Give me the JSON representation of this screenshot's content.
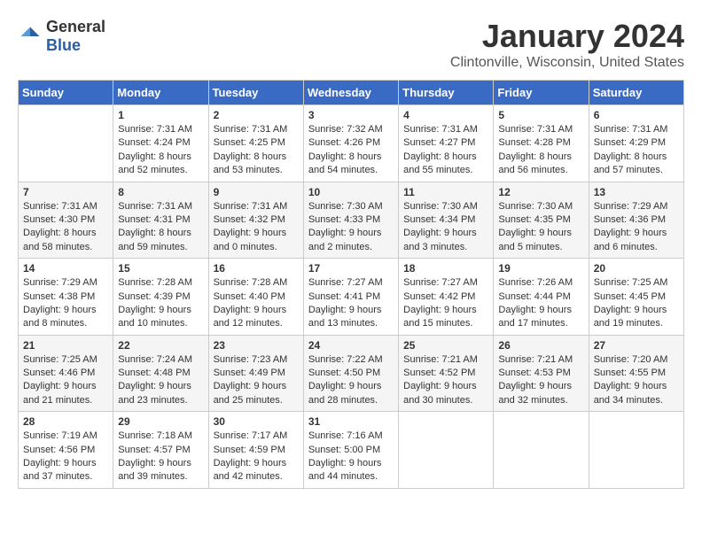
{
  "header": {
    "logo_general": "General",
    "logo_blue": "Blue",
    "month_title": "January 2024",
    "location": "Clintonville, Wisconsin, United States"
  },
  "days_of_week": [
    "Sunday",
    "Monday",
    "Tuesday",
    "Wednesday",
    "Thursday",
    "Friday",
    "Saturday"
  ],
  "weeks": [
    [
      {
        "day": "",
        "sunrise": "",
        "sunset": "",
        "daylight": ""
      },
      {
        "day": "1",
        "sunrise": "Sunrise: 7:31 AM",
        "sunset": "Sunset: 4:24 PM",
        "daylight": "Daylight: 8 hours and 52 minutes."
      },
      {
        "day": "2",
        "sunrise": "Sunrise: 7:31 AM",
        "sunset": "Sunset: 4:25 PM",
        "daylight": "Daylight: 8 hours and 53 minutes."
      },
      {
        "day": "3",
        "sunrise": "Sunrise: 7:32 AM",
        "sunset": "Sunset: 4:26 PM",
        "daylight": "Daylight: 8 hours and 54 minutes."
      },
      {
        "day": "4",
        "sunrise": "Sunrise: 7:31 AM",
        "sunset": "Sunset: 4:27 PM",
        "daylight": "Daylight: 8 hours and 55 minutes."
      },
      {
        "day": "5",
        "sunrise": "Sunrise: 7:31 AM",
        "sunset": "Sunset: 4:28 PM",
        "daylight": "Daylight: 8 hours and 56 minutes."
      },
      {
        "day": "6",
        "sunrise": "Sunrise: 7:31 AM",
        "sunset": "Sunset: 4:29 PM",
        "daylight": "Daylight: 8 hours and 57 minutes."
      }
    ],
    [
      {
        "day": "7",
        "sunrise": "Sunrise: 7:31 AM",
        "sunset": "Sunset: 4:30 PM",
        "daylight": "Daylight: 8 hours and 58 minutes."
      },
      {
        "day": "8",
        "sunrise": "Sunrise: 7:31 AM",
        "sunset": "Sunset: 4:31 PM",
        "daylight": "Daylight: 8 hours and 59 minutes."
      },
      {
        "day": "9",
        "sunrise": "Sunrise: 7:31 AM",
        "sunset": "Sunset: 4:32 PM",
        "daylight": "Daylight: 9 hours and 0 minutes."
      },
      {
        "day": "10",
        "sunrise": "Sunrise: 7:30 AM",
        "sunset": "Sunset: 4:33 PM",
        "daylight": "Daylight: 9 hours and 2 minutes."
      },
      {
        "day": "11",
        "sunrise": "Sunrise: 7:30 AM",
        "sunset": "Sunset: 4:34 PM",
        "daylight": "Daylight: 9 hours and 3 minutes."
      },
      {
        "day": "12",
        "sunrise": "Sunrise: 7:30 AM",
        "sunset": "Sunset: 4:35 PM",
        "daylight": "Daylight: 9 hours and 5 minutes."
      },
      {
        "day": "13",
        "sunrise": "Sunrise: 7:29 AM",
        "sunset": "Sunset: 4:36 PM",
        "daylight": "Daylight: 9 hours and 6 minutes."
      }
    ],
    [
      {
        "day": "14",
        "sunrise": "Sunrise: 7:29 AM",
        "sunset": "Sunset: 4:38 PM",
        "daylight": "Daylight: 9 hours and 8 minutes."
      },
      {
        "day": "15",
        "sunrise": "Sunrise: 7:28 AM",
        "sunset": "Sunset: 4:39 PM",
        "daylight": "Daylight: 9 hours and 10 minutes."
      },
      {
        "day": "16",
        "sunrise": "Sunrise: 7:28 AM",
        "sunset": "Sunset: 4:40 PM",
        "daylight": "Daylight: 9 hours and 12 minutes."
      },
      {
        "day": "17",
        "sunrise": "Sunrise: 7:27 AM",
        "sunset": "Sunset: 4:41 PM",
        "daylight": "Daylight: 9 hours and 13 minutes."
      },
      {
        "day": "18",
        "sunrise": "Sunrise: 7:27 AM",
        "sunset": "Sunset: 4:42 PM",
        "daylight": "Daylight: 9 hours and 15 minutes."
      },
      {
        "day": "19",
        "sunrise": "Sunrise: 7:26 AM",
        "sunset": "Sunset: 4:44 PM",
        "daylight": "Daylight: 9 hours and 17 minutes."
      },
      {
        "day": "20",
        "sunrise": "Sunrise: 7:25 AM",
        "sunset": "Sunset: 4:45 PM",
        "daylight": "Daylight: 9 hours and 19 minutes."
      }
    ],
    [
      {
        "day": "21",
        "sunrise": "Sunrise: 7:25 AM",
        "sunset": "Sunset: 4:46 PM",
        "daylight": "Daylight: 9 hours and 21 minutes."
      },
      {
        "day": "22",
        "sunrise": "Sunrise: 7:24 AM",
        "sunset": "Sunset: 4:48 PM",
        "daylight": "Daylight: 9 hours and 23 minutes."
      },
      {
        "day": "23",
        "sunrise": "Sunrise: 7:23 AM",
        "sunset": "Sunset: 4:49 PM",
        "daylight": "Daylight: 9 hours and 25 minutes."
      },
      {
        "day": "24",
        "sunrise": "Sunrise: 7:22 AM",
        "sunset": "Sunset: 4:50 PM",
        "daylight": "Daylight: 9 hours and 28 minutes."
      },
      {
        "day": "25",
        "sunrise": "Sunrise: 7:21 AM",
        "sunset": "Sunset: 4:52 PM",
        "daylight": "Daylight: 9 hours and 30 minutes."
      },
      {
        "day": "26",
        "sunrise": "Sunrise: 7:21 AM",
        "sunset": "Sunset: 4:53 PM",
        "daylight": "Daylight: 9 hours and 32 minutes."
      },
      {
        "day": "27",
        "sunrise": "Sunrise: 7:20 AM",
        "sunset": "Sunset: 4:55 PM",
        "daylight": "Daylight: 9 hours and 34 minutes."
      }
    ],
    [
      {
        "day": "28",
        "sunrise": "Sunrise: 7:19 AM",
        "sunset": "Sunset: 4:56 PM",
        "daylight": "Daylight: 9 hours and 37 minutes."
      },
      {
        "day": "29",
        "sunrise": "Sunrise: 7:18 AM",
        "sunset": "Sunset: 4:57 PM",
        "daylight": "Daylight: 9 hours and 39 minutes."
      },
      {
        "day": "30",
        "sunrise": "Sunrise: 7:17 AM",
        "sunset": "Sunset: 4:59 PM",
        "daylight": "Daylight: 9 hours and 42 minutes."
      },
      {
        "day": "31",
        "sunrise": "Sunrise: 7:16 AM",
        "sunset": "Sunset: 5:00 PM",
        "daylight": "Daylight: 9 hours and 44 minutes."
      },
      {
        "day": "",
        "sunrise": "",
        "sunset": "",
        "daylight": ""
      },
      {
        "day": "",
        "sunrise": "",
        "sunset": "",
        "daylight": ""
      },
      {
        "day": "",
        "sunrise": "",
        "sunset": "",
        "daylight": ""
      }
    ]
  ]
}
